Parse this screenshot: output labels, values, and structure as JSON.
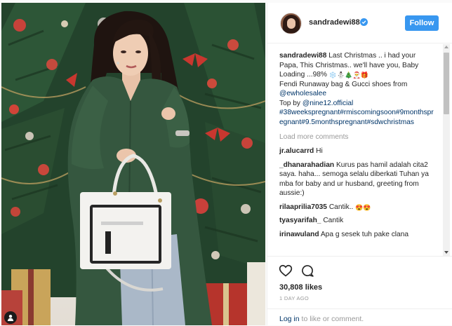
{
  "post": {
    "username": "sandradewi88",
    "follow_label": "Follow",
    "caption": {
      "author": "sandradewi88",
      "line1": "Last Christmas .. i had your Papa, This Christmas.. we'll have you, Baby Loading ...98%",
      "emojis": [
        "❄️",
        "⛄",
        "🎄",
        "🎅",
        "🎁"
      ],
      "line2": "Fendi Runaway bag & Gucci shoes from",
      "mention1": "@ewholesalee",
      "line3": "Top by",
      "mention2": "@nine12.official",
      "hashtags": "#38weekspregnant#rmiscomingsoon#9monthspregnant#9.5monthspregnant#sdwchristmas"
    },
    "load_more_label": "Load more comments",
    "comments": [
      {
        "user": "jr.alucarrd",
        "text": "Hi"
      },
      {
        "user": "_dhanarahadian",
        "text": "Kurus pas hamil adalah cita2 saya. haha... semoga selalu diberkati Tuhan ya mba for baby and ur husband, greeting from aussie:)"
      },
      {
        "user": "rilaaprilia7035",
        "text": "Cantik..",
        "emojis": [
          "😍",
          "😍"
        ]
      },
      {
        "user": "tyasyarifah_",
        "text": "Cantik"
      },
      {
        "user": "irinawuland",
        "text": "Apa g sesek tuh pake clana"
      }
    ],
    "likes_label": "30,808 likes",
    "time_ago": "1 DAY AGO",
    "login_link": "Log in",
    "login_rest": " to like or comment."
  },
  "icons": {
    "like": "heart-icon",
    "comment": "comment-bubble-icon",
    "verified": "verified-badge-icon",
    "user_tag": "user-tag-icon"
  },
  "colors": {
    "accent": "#3897f0",
    "link": "#003569",
    "muted": "#999999",
    "dress": "#355840"
  }
}
